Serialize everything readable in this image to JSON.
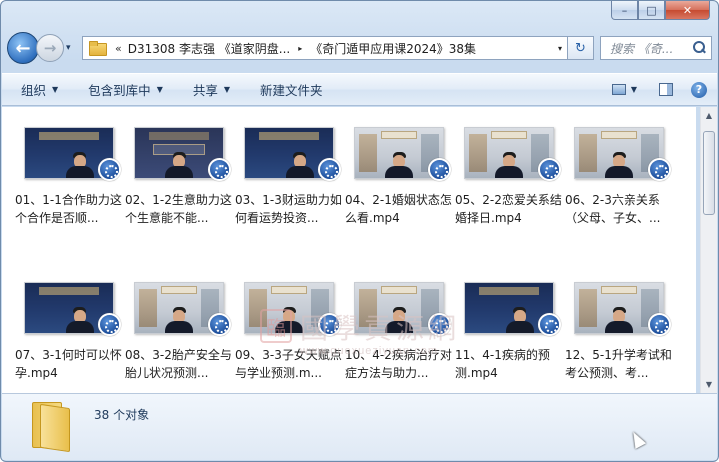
{
  "window": {
    "controls": {
      "minimize": "–",
      "maximize": "□",
      "close": "✕"
    }
  },
  "nav": {
    "back_icon": "back-arrow-icon",
    "forward_icon": "forward-arrow-icon",
    "recent_dropdown": "▾"
  },
  "address": {
    "overflow": "«",
    "crumbs": [
      "D31308 李志强 《道家阴盘...",
      "《奇门遁甲应用课2024》38集"
    ],
    "separator": "▸",
    "dropdown": "▾",
    "refresh": "↻"
  },
  "search": {
    "placeholder": "搜索 《奇..."
  },
  "toolbar": {
    "organize": "组织",
    "include_in_library": "包含到库中",
    "share": "共享",
    "new_folder": "新建文件夹",
    "help": "?"
  },
  "files": [
    {
      "name": "01、1-1合作助力这个合作是否顺...",
      "thumb": "navy"
    },
    {
      "name": "02、1-2生意助力这个生意能不能...",
      "thumb": "stage"
    },
    {
      "name": "03、1-3财运助力如何看运势投资...",
      "thumb": "navy"
    },
    {
      "name": "04、2-1婚姻状态怎么看.mp4",
      "thumb": "office"
    },
    {
      "name": "05、2-2恋爱关系结婚择日.mp4",
      "thumb": "office"
    },
    {
      "name": "06、2-3六亲关系（父母、子女、...",
      "thumb": "office"
    },
    {
      "name": "07、3-1何时可以怀孕.mp4",
      "thumb": "navy"
    },
    {
      "name": "08、3-2胎产安全与胎儿状况预测...",
      "thumb": "office"
    },
    {
      "name": "09、3-3子女天赋点与学业预测.m...",
      "thumb": "office"
    },
    {
      "name": "10、4-2疾病治疗对症方法与助力...",
      "thumb": "office"
    },
    {
      "name": "11、4-1疾病的预测.mp4",
      "thumb": "navy"
    },
    {
      "name": "12、5-1升学考试和考公预测、考...",
      "thumb": "office"
    }
  ],
  "watermark": {
    "seal": "臨",
    "text": "國學貢源網",
    "url": "www.guoxueziyuan.com"
  },
  "details": {
    "count": "38 个对象"
  }
}
